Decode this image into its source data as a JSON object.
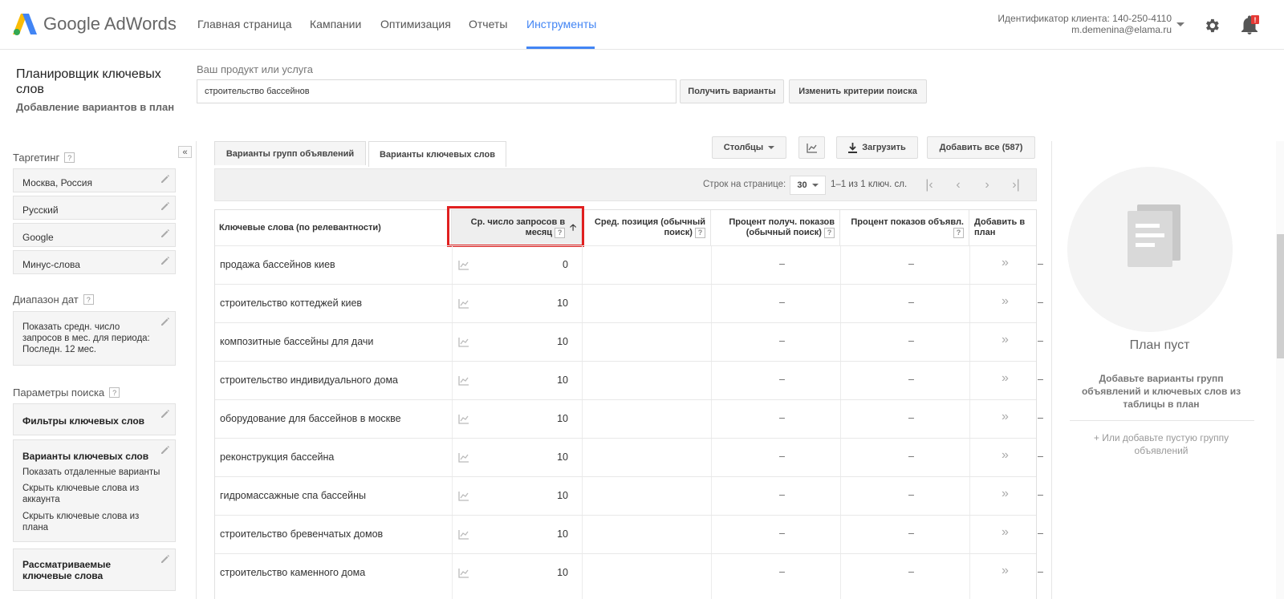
{
  "app": {
    "logo_text": "Google AdWords"
  },
  "nav": [
    "Главная страница",
    "Кампании",
    "Оптимизация",
    "Отчеты",
    "Инструменты"
  ],
  "account": {
    "client_id": "Идентификатор клиента: 140-250-4110",
    "email": "m.demenina@elama.ru",
    "notification_badge": "!"
  },
  "header": {
    "title": "Планировщик ключевых слов",
    "subtitle": "Добавление вариантов в план",
    "product_label": "Ваш продукт или услуга",
    "product_value": "строительство бассейнов",
    "get_variants": "Получить варианты",
    "change_criteria": "Изменить критерии поиска"
  },
  "left": {
    "collapse": "«",
    "targeting_title": "Таргетинг",
    "targeting_items": [
      "Москва, Россия",
      "Русский",
      "Google",
      "Минус-слова"
    ],
    "date_title": "Диапазон дат",
    "date_text": "Показать средн. число запросов в мес. для периода: Последн. 12 мес.",
    "search_params_title": "Параметры поиска",
    "keyword_filters": "Фильтры ключевых слов",
    "keyword_variants_title": "Варианты ключевых слов",
    "keyword_variants_items": [
      "Показать отдаленные варианты",
      "Скрыть ключевые слова из аккаунта",
      "Скрыть ключевые слова из плана"
    ],
    "considered_keywords": "Рассматриваемые ключевые слова",
    "help": "?"
  },
  "tabs": {
    "ad_groups": "Варианты групп объявлений",
    "keywords": "Варианты ключевых слов"
  },
  "toolbar": {
    "columns": "Столбцы",
    "download": "Загрузить",
    "add_all": "Добавить все (587)"
  },
  "pager": {
    "rows_label": "Строк на странице:",
    "rows_value": "30",
    "range": "1–1 из 1 ключ. сл."
  },
  "table": {
    "headers": {
      "keyword": "Ключевые слова (по релевантности)",
      "avg_searches_1": "Ср. число запросов в",
      "avg_searches_2": "месяц",
      "avg_pos_1": "Сред. позиция (обычный",
      "avg_pos_2": "поиск)",
      "impr_share_1": "Процент получ. показов",
      "impr_share_2": "(обычный поиск)",
      "ad_impr": "Процент показов объявл.",
      "add_to_plan_1": "Добавить в",
      "add_to_plan_2": "план"
    },
    "rows": [
      {
        "keyword": "продажа бассейнов киев",
        "searches": "0",
        "pos": "–",
        "impr": "–",
        "ad": "–",
        "add": "»"
      },
      {
        "keyword": "строительство коттеджей киев",
        "searches": "10",
        "pos": "–",
        "impr": "–",
        "ad": "–",
        "add": "»"
      },
      {
        "keyword": "композитные бассейны для дачи",
        "searches": "10",
        "pos": "–",
        "impr": "–",
        "ad": "–",
        "add": "»"
      },
      {
        "keyword": "строительство индивидуального дома",
        "searches": "10",
        "pos": "–",
        "impr": "–",
        "ad": "–",
        "add": "»"
      },
      {
        "keyword": "оборудование для бассейнов в москве",
        "searches": "10",
        "pos": "–",
        "impr": "–",
        "ad": "–",
        "add": "»"
      },
      {
        "keyword": "реконструкция бассейна",
        "searches": "10",
        "pos": "–",
        "impr": "–",
        "ad": "–",
        "add": "»"
      },
      {
        "keyword": "гидромассажные спа бассейны",
        "searches": "10",
        "pos": "–",
        "impr": "–",
        "ad": "–",
        "add": "»"
      },
      {
        "keyword": "строительство бревенчатых домов",
        "searches": "10",
        "pos": "–",
        "impr": "–",
        "ad": "–",
        "add": "»"
      },
      {
        "keyword": "строительство каменного дома",
        "searches": "10",
        "pos": "–",
        "impr": "–",
        "ad": "–",
        "add": "»"
      }
    ]
  },
  "plan": {
    "empty_title": "План пуст",
    "hint": "Добавьте варианты групп объявлений и ключевых слов из таблицы в план",
    "add_empty": "+ Или добавьте пустую группу объявлений"
  },
  "colors": {
    "accent": "#4285f4",
    "highlight": "#e02020"
  }
}
